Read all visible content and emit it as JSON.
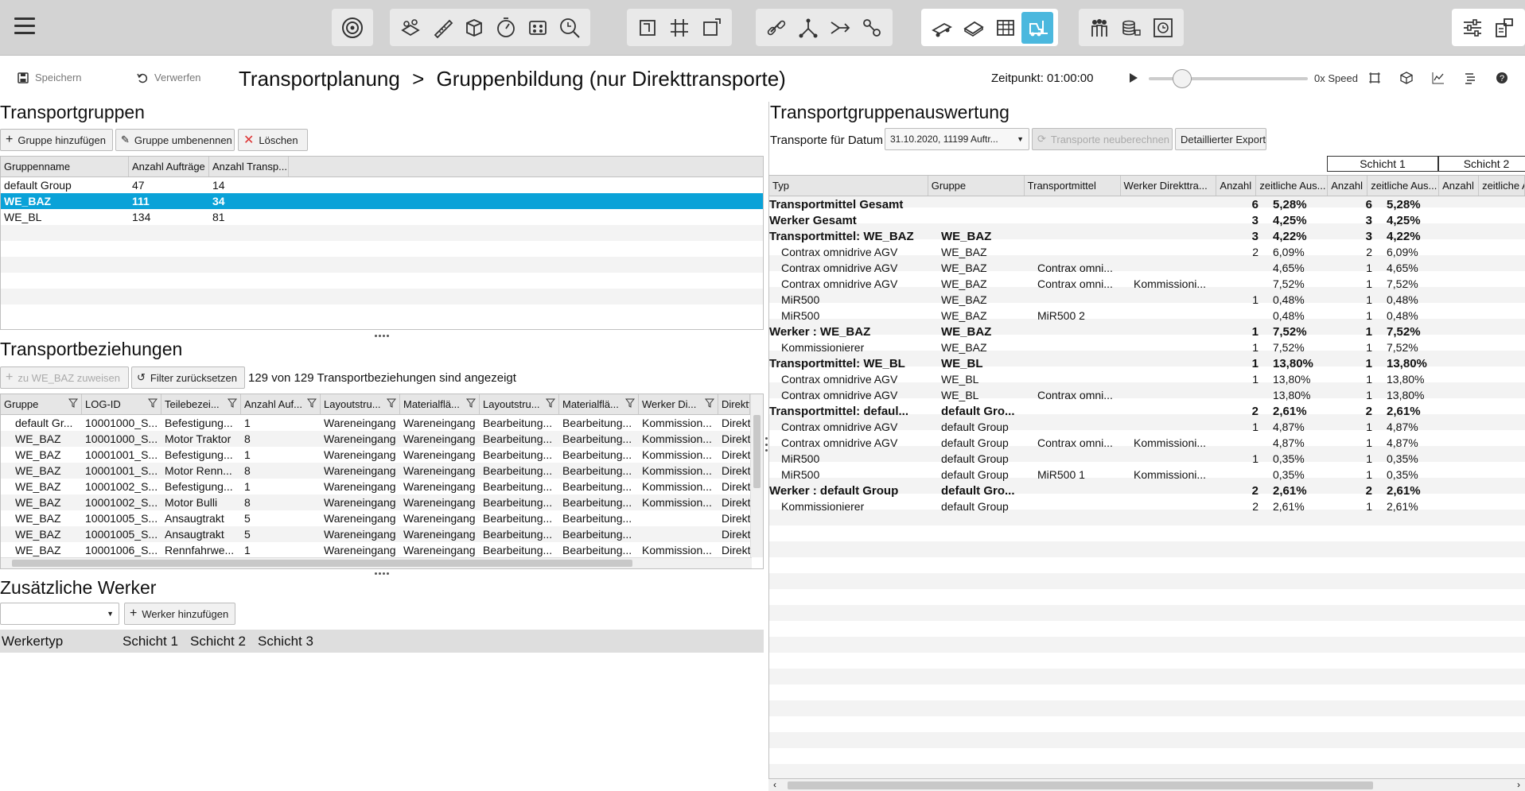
{
  "toolbar": {
    "menu_icon": "hamburger-icon",
    "groups": [
      [
        "target-icon"
      ],
      [
        "layers-icon",
        "ruler-icon",
        "cube-icon",
        "stopwatch-icon",
        "grid-icon",
        "search-target-icon"
      ],
      [
        "frame-icon",
        "hash-grid-icon",
        "transform-icon"
      ],
      [
        "link-icon",
        "branch-icon",
        "merge-icon",
        "chain-icon"
      ],
      [
        "truck-icon",
        "sheet-icon",
        "table-icon",
        "forklift-icon"
      ],
      [
        "people-icon",
        "coins-icon",
        "clock-frame-icon"
      ],
      [
        "sliders-icon",
        "structure-icon"
      ]
    ],
    "active_icon": "forklift-icon"
  },
  "actions": {
    "save_label": "Speichern",
    "discard_label": "Verwerfen"
  },
  "page": {
    "title_main": "Transportplanung",
    "title_sep": ">",
    "title_sub": "Gruppenbildung (nur Direkttransporte)",
    "time_label": "Zeitpunkt: 01:00:00",
    "speed_label": "0x Speed",
    "speed_level": 0.21
  },
  "groups": {
    "section_title": "Transportgruppen",
    "add_label": "Gruppe hinzufügen",
    "rename_label": "Gruppe umbenennen",
    "delete_label": "Löschen",
    "columns": [
      "Gruppenname",
      "Anzahl Aufträge",
      "Anzahl Transp..."
    ],
    "rows": [
      [
        "default Group",
        "47",
        "14"
      ],
      [
        "WE_BAZ",
        "111",
        "34"
      ],
      [
        "WE_BL",
        "134",
        "81"
      ]
    ],
    "selected_row": 1
  },
  "relations": {
    "section_title": "Transportbeziehungen",
    "assign_label": "zu WE_BAZ zuweisen",
    "reset_label": "Filter zurücksetzen",
    "count_text": "129 von 129 Transportbeziehungen sind angezeigt",
    "columns": [
      "Gruppe",
      "LOG-ID",
      "Teilebezei...",
      "Anzahl Auf...",
      "Layoutstru...",
      "Materialflä...",
      "Layoutstru...",
      "Materialflä...",
      "Werker Di...",
      "Direktt"
    ],
    "rows": [
      [
        "default Gr...",
        "10001000_S...",
        "Befestigung...",
        "1",
        "Wareneingang",
        "Wareneingang",
        "Bearbeitung...",
        "Bearbeitung...",
        "Kommission...",
        "Direkt"
      ],
      [
        "WE_BAZ",
        "10001000_S...",
        "Motor Traktor",
        "8",
        "Wareneingang",
        "Wareneingang",
        "Bearbeitung...",
        "Bearbeitung...",
        "Kommission...",
        "Direkt"
      ],
      [
        "WE_BAZ",
        "10001001_S...",
        "Befestigung...",
        "1",
        "Wareneingang",
        "Wareneingang",
        "Bearbeitung...",
        "Bearbeitung...",
        "Kommission...",
        "Direkt"
      ],
      [
        "WE_BAZ",
        "10001001_S...",
        "Motor Renn...",
        "8",
        "Wareneingang",
        "Wareneingang",
        "Bearbeitung...",
        "Bearbeitung...",
        "Kommission...",
        "Direkt"
      ],
      [
        "WE_BAZ",
        "10001002_S...",
        "Befestigung...",
        "1",
        "Wareneingang",
        "Wareneingang",
        "Bearbeitung...",
        "Bearbeitung...",
        "Kommission...",
        "Direkt"
      ],
      [
        "WE_BAZ",
        "10001002_S...",
        "Motor Bulli",
        "8",
        "Wareneingang",
        "Wareneingang",
        "Bearbeitung...",
        "Bearbeitung...",
        "Kommission...",
        "Direkt"
      ],
      [
        "WE_BAZ",
        "10001005_S...",
        "Ansaugtrakt",
        "5",
        "Wareneingang",
        "Wareneingang",
        "Bearbeitung...",
        "Bearbeitung...",
        "",
        "Direkt"
      ],
      [
        "WE_BAZ",
        "10001005_S...",
        "Ansaugtrakt",
        "5",
        "Wareneingang",
        "Wareneingang",
        "Bearbeitung...",
        "Bearbeitung...",
        "",
        "Direkt"
      ],
      [
        "WE_BAZ",
        "10001006_S...",
        "Rennfahrwe...",
        "1",
        "Wareneingang",
        "Wareneingang",
        "Bearbeitung...",
        "Bearbeitung...",
        "Kommission...",
        "Direkt"
      ]
    ]
  },
  "workers": {
    "section_title": "Zusätzliche Werker",
    "select_value": "",
    "add_label": "Werker hinzufügen",
    "columns": [
      "Werkertyp",
      "Schicht 1",
      "Schicht 2",
      "Schicht 3"
    ]
  },
  "evaluation": {
    "section_title": "Transportgruppenauswertung",
    "date_label": "Transporte für Datum",
    "date_value": "31.10.2020, 11199 Auftr...",
    "recalc_label": "Transporte neuberechnen",
    "export_label": "Detaillierter Export",
    "shifts": [
      "Schicht 1",
      "Schicht 2"
    ],
    "columns": [
      "Typ",
      "Gruppe",
      "Transportmittel",
      "Werker Direkttra...",
      "Anzahl",
      "zeitliche Aus...",
      "Anzahl",
      "zeitliche Aus...",
      "Anzahl",
      "zeitliche A"
    ],
    "rows": [
      {
        "bold": true,
        "c": [
          "Transportmittel Gesamt",
          "",
          "",
          "",
          "6",
          "5,28%",
          "6",
          "5,28%"
        ]
      },
      {
        "bold": true,
        "c": [
          "Werker Gesamt",
          "",
          "",
          "",
          "3",
          "4,25%",
          "3",
          "4,25%"
        ]
      },
      {
        "bold": true,
        "c": [
          "Transportmittel: WE_BAZ",
          "WE_BAZ",
          "",
          "",
          "3",
          "4,22%",
          "3",
          "4,22%"
        ]
      },
      {
        "bold": false,
        "c": [
          "Contrax omnidrive AGV",
          "WE_BAZ",
          "",
          "",
          "2",
          "6,09%",
          "2",
          "6,09%"
        ]
      },
      {
        "bold": false,
        "c": [
          "Contrax omnidrive AGV",
          "WE_BAZ",
          "Contrax omni...",
          "",
          "",
          "4,65%",
          "1",
          "4,65%"
        ]
      },
      {
        "bold": false,
        "c": [
          "Contrax omnidrive AGV",
          "WE_BAZ",
          "Contrax omni...",
          "Kommissioni...",
          "",
          "7,52%",
          "1",
          "7,52%"
        ]
      },
      {
        "bold": false,
        "c": [
          "MiR500",
          "WE_BAZ",
          "",
          "",
          "1",
          "0,48%",
          "1",
          "0,48%"
        ]
      },
      {
        "bold": false,
        "c": [
          "MiR500",
          "WE_BAZ",
          "MiR500 2",
          "",
          "",
          "0,48%",
          "1",
          "0,48%"
        ]
      },
      {
        "bold": true,
        "c": [
          "Werker : WE_BAZ",
          "WE_BAZ",
          "",
          "",
          "1",
          "7,52%",
          "1",
          "7,52%"
        ]
      },
      {
        "bold": false,
        "c": [
          "Kommissionierer",
          "WE_BAZ",
          "",
          "",
          "1",
          "7,52%",
          "1",
          "7,52%"
        ]
      },
      {
        "bold": true,
        "c": [
          "Transportmittel: WE_BL",
          "WE_BL",
          "",
          "",
          "1",
          "13,80%",
          "1",
          "13,80%"
        ]
      },
      {
        "bold": false,
        "c": [
          "Contrax omnidrive AGV",
          "WE_BL",
          "",
          "",
          "1",
          "13,80%",
          "1",
          "13,80%"
        ]
      },
      {
        "bold": false,
        "c": [
          "Contrax omnidrive AGV",
          "WE_BL",
          "Contrax omni...",
          "",
          "",
          "13,80%",
          "1",
          "13,80%"
        ]
      },
      {
        "bold": true,
        "c": [
          "Transportmittel: defaul...",
          "default Gro...",
          "",
          "",
          "2",
          "2,61%",
          "2",
          "2,61%"
        ]
      },
      {
        "bold": false,
        "c": [
          "Contrax omnidrive AGV",
          "default Group",
          "",
          "",
          "1",
          "4,87%",
          "1",
          "4,87%"
        ]
      },
      {
        "bold": false,
        "c": [
          "Contrax omnidrive AGV",
          "default Group",
          "Contrax omni...",
          "Kommissioni...",
          "",
          "4,87%",
          "1",
          "4,87%"
        ]
      },
      {
        "bold": false,
        "c": [
          "MiR500",
          "default Group",
          "",
          "",
          "1",
          "0,35%",
          "1",
          "0,35%"
        ]
      },
      {
        "bold": false,
        "c": [
          "MiR500",
          "default Group",
          "MiR500 1",
          "Kommissioni...",
          "",
          "0,35%",
          "1",
          "0,35%"
        ]
      },
      {
        "bold": true,
        "c": [
          "Werker : default Group",
          "default Gro...",
          "",
          "",
          "2",
          "2,61%",
          "2",
          "2,61%"
        ]
      },
      {
        "bold": false,
        "c": [
          "Kommissionierer",
          "default Group",
          "",
          "",
          "2",
          "2,61%",
          "1",
          "2,61%"
        ]
      }
    ]
  },
  "colors": {
    "accent": "#0aa2d8",
    "toolbar_bg": "#d3d3d3",
    "active_tool": "#4bb8de"
  }
}
